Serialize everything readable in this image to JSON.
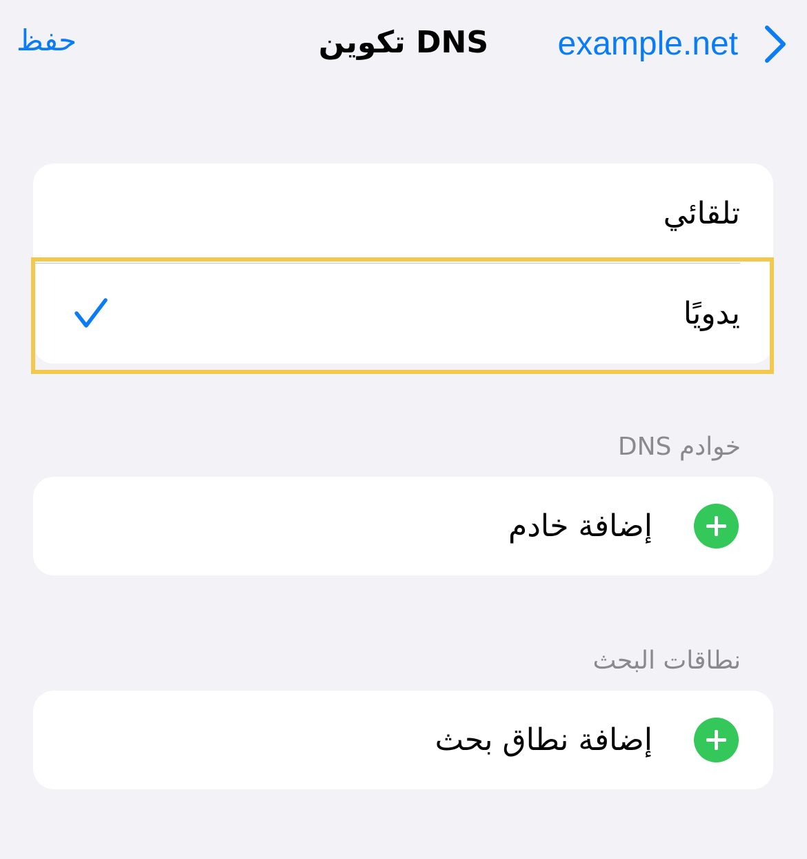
{
  "nav": {
    "save_label": "حفظ",
    "title": "تكوين DNS",
    "back_label": "example.net"
  },
  "mode": {
    "options": [
      {
        "label": "تلقائي",
        "selected": false
      },
      {
        "label": "يدويًا",
        "selected": true
      }
    ]
  },
  "servers": {
    "header": "خوادم DNS",
    "add_label": "إضافة خادم"
  },
  "search_domains": {
    "header": "نطاقات البحث",
    "add_label": "إضافة نطاق بحث"
  },
  "icons": {
    "back": "chevron-right-icon",
    "check": "checkmark-icon",
    "add": "plus-circle-icon"
  },
  "colors": {
    "accent": "#0a7cf5",
    "add_green": "#34c759",
    "background": "#f2f2f7",
    "highlight": "#f2c94c",
    "secondary_text": "#8a8a8e"
  }
}
